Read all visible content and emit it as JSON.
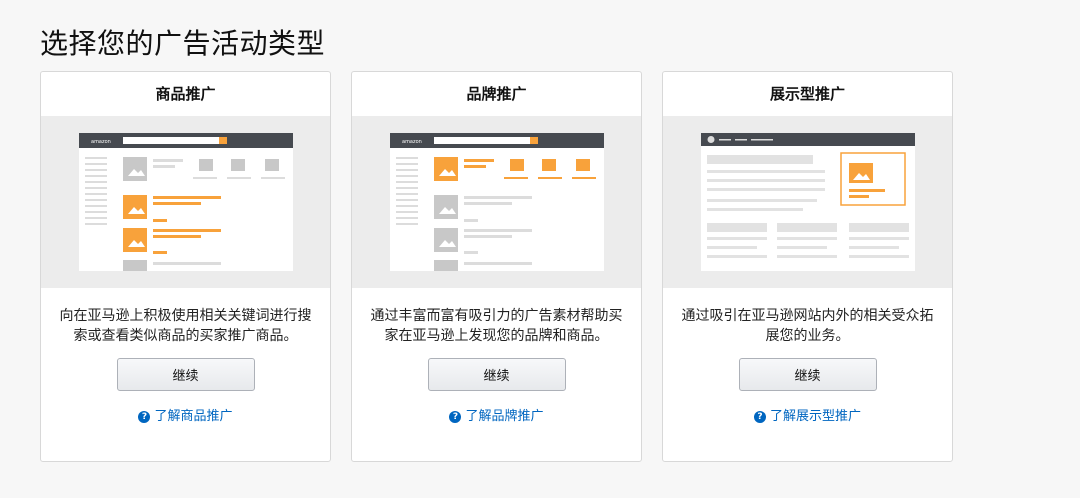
{
  "page": {
    "title": "选择您的广告活动类型"
  },
  "cards": [
    {
      "title": "商品推广",
      "mock_logo": "amazon",
      "description": "向在亚马逊上积极使用相关关键词进行搜索或查看类似商品的买家推广商品。",
      "button_label": "继续",
      "learn_more": "了解商品推广",
      "icon": "product-listing-mockup"
    },
    {
      "title": "品牌推广",
      "mock_logo": "amazon",
      "description": "通过丰富而富有吸引力的广告素材帮助买家在亚马逊上发现您的品牌和商品。",
      "button_label": "继续",
      "learn_more": "了解品牌推广",
      "icon": "brand-banner-mockup"
    },
    {
      "title": "展示型推广",
      "description": "通过吸引在亚马逊网站内外的相关受众拓展您的业务。",
      "button_label": "继续",
      "learn_more": "了解展示型推广",
      "icon": "display-ad-mockup"
    }
  ],
  "colors": {
    "accent": "#f8a23b",
    "link": "#0066c0",
    "mock_header": "#464a50"
  }
}
